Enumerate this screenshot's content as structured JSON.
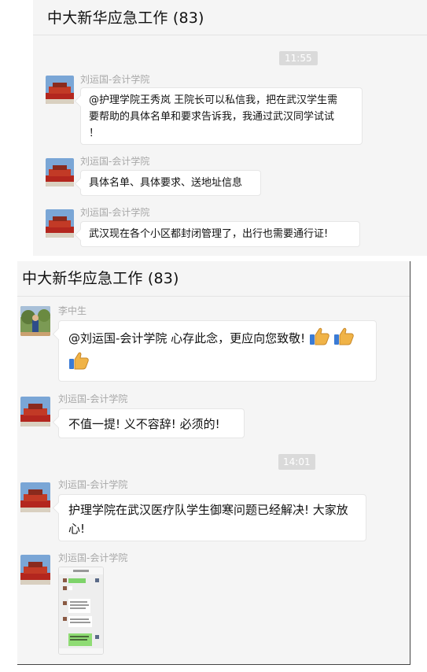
{
  "top_chat": {
    "title": "中大新华应急工作 (83)",
    "time": "11:55",
    "messages": [
      {
        "sender": "刘运国-会计学院",
        "line1": "@护理学院王秀岚 王院长可以私信我，把在武汉学生需",
        "line2": "要帮助的具体名单和要求告诉我，我通过武汉同学试试",
        "line3": "！"
      },
      {
        "sender": "刘运国-会计学院",
        "text": "具体名单、具体要求、送地址信息"
      },
      {
        "sender": "刘运国-会计学院",
        "text": "武汉现在各个小区都封闭管理了，出行也需要通行证!"
      }
    ]
  },
  "bottom_chat": {
    "title": "中大新华应急工作 (83)",
    "messages": [
      {
        "sender": "李中生",
        "text": "@刘运国-会计学院 心存此念，更应向您致敬!",
        "emoji": "thumbs-up-icon"
      },
      {
        "sender": "刘运国-会计学院",
        "text": "不值一提! 义不容辞! 必须的!"
      },
      {
        "sender": "刘运国-会计学院",
        "line1": "护理学院在武汉医疗队学生御寒问题已经解决! 大家放",
        "line2": "心!"
      },
      {
        "sender": "刘运国-会计学院",
        "type": "image"
      }
    ],
    "time": "14:01"
  }
}
